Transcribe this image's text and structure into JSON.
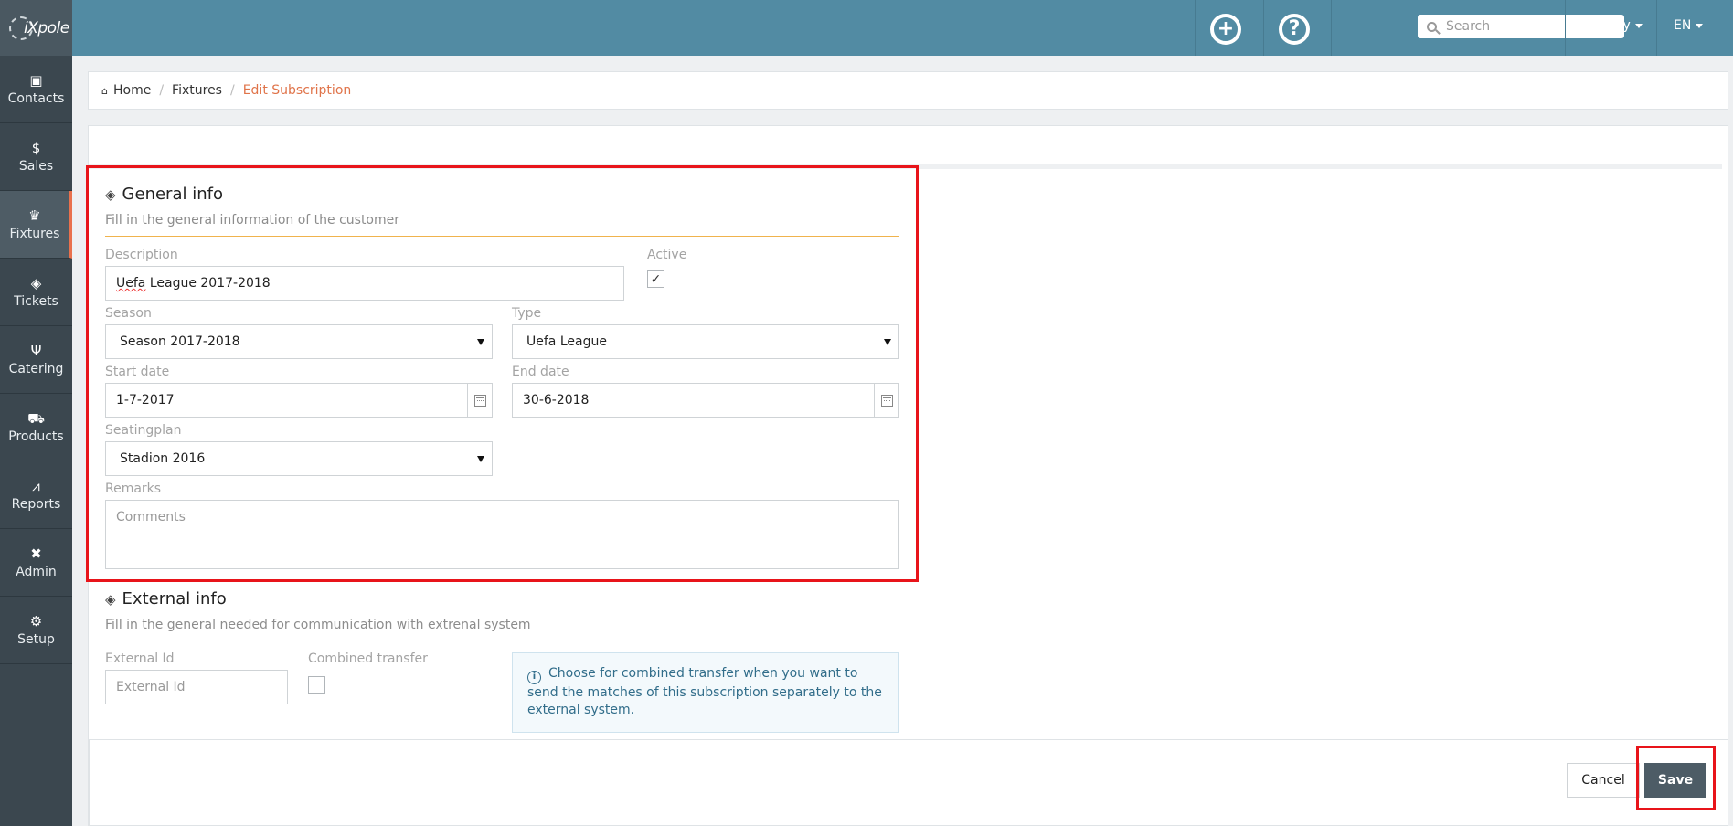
{
  "logo": {
    "text": "iXpole"
  },
  "sidebar": {
    "items": [
      {
        "label": "Contacts",
        "icon": "contacts-icon"
      },
      {
        "label": "Sales",
        "icon": "dollar-icon"
      },
      {
        "label": "Fixtures",
        "icon": "trophy-icon",
        "active": true
      },
      {
        "label": "Tickets",
        "icon": "ticket-icon"
      },
      {
        "label": "Catering",
        "icon": "cutlery-icon"
      },
      {
        "label": "Products",
        "icon": "cart-icon"
      },
      {
        "label": "Reports",
        "icon": "chart-icon"
      },
      {
        "label": "Admin",
        "icon": "tools-icon"
      },
      {
        "label": "Setup",
        "icon": "gear-icon"
      }
    ]
  },
  "topbar": {
    "add_icon": "plus-circle-icon",
    "help_icon": "help-circle-icon",
    "search_placeholder": "Search",
    "user": "Robby",
    "language": "EN"
  },
  "breadcrumb": {
    "home": "Home",
    "section": "Fixtures",
    "current": "Edit Subscription"
  },
  "general": {
    "title": "General info",
    "subtitle": "Fill in the general information of the customer",
    "description_label": "Description",
    "description_value_word": "Uefa",
    "description_value_rest": " League 2017-2018",
    "active_label": "Active",
    "active_checked": true,
    "season_label": "Season",
    "season_value": "Season 2017-2018",
    "type_label": "Type",
    "type_value": "Uefa League",
    "start_label": "Start date",
    "start_value": "1-7-2017",
    "end_label": "End date",
    "end_value": "30-6-2018",
    "seating_label": "Seatingplan",
    "seating_value": "Stadion 2016",
    "remarks_label": "Remarks",
    "remarks_placeholder": "Comments"
  },
  "external": {
    "title": "External info",
    "subtitle": "Fill in the general needed for communication with extrenal system",
    "id_label": "External Id",
    "id_placeholder": "External Id",
    "combined_label": "Combined transfer",
    "combined_checked": false,
    "info_text": "Choose for combined transfer when you want to send the matches of this subscription separately to the external system."
  },
  "actions": {
    "cancel": "Cancel",
    "save": "Save"
  },
  "colors": {
    "topbar": "#528ba3",
    "sidebar": "#3b474f",
    "accent": "#e0744a",
    "section_rule": "#f0b34d",
    "save_button": "#4d5c66",
    "highlight": "#e8141a"
  }
}
